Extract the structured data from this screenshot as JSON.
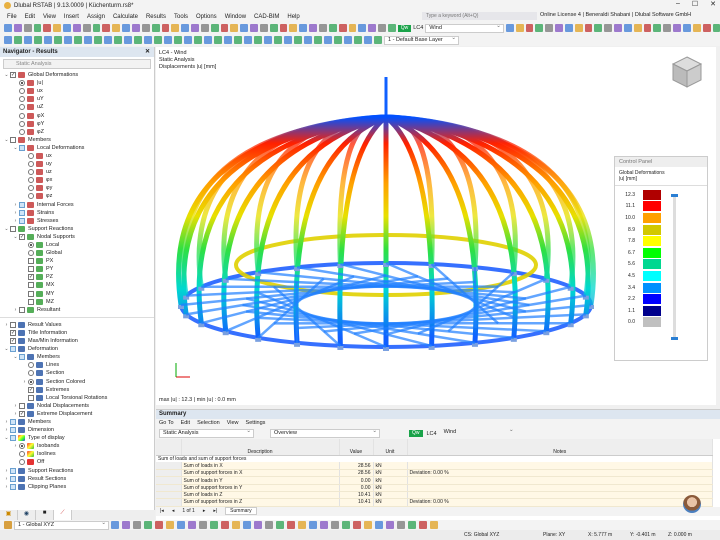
{
  "app": {
    "title": "Dlubal RSTAB | 9.13.0009 | Küchenturm.rs8*",
    "search_placeholder": "Type a keyword (Alt+Q)",
    "license": "Online License 4 | Beneraldi Shabani | Dlubal Software GmbH"
  },
  "menu": [
    "File",
    "Edit",
    "View",
    "Insert",
    "Assign",
    "Calculate",
    "Results",
    "Tools",
    "Options",
    "Window",
    "CAD-BIM",
    "Help"
  ],
  "toolbar": {
    "load_case_badge": "Qw",
    "load_case": "LC4",
    "load_case_name": "Wind",
    "layer": "1 - Default Base Layer"
  },
  "navigator": {
    "title": "Navigator - Results",
    "analysis": "Static Analysis",
    "tree": [
      {
        "lvl": 0,
        "exp": "v",
        "ctl": "box",
        "on": true,
        "icon": "deform",
        "label": "Global Deformations"
      },
      {
        "lvl": 1,
        "ctl": "rad",
        "on": true,
        "icon": "deform",
        "label": "|u|"
      },
      {
        "lvl": 1,
        "ctl": "rad",
        "icon": "deform",
        "label": "ux"
      },
      {
        "lvl": 1,
        "ctl": "rad",
        "icon": "deform",
        "label": "uY"
      },
      {
        "lvl": 1,
        "ctl": "rad",
        "icon": "deform",
        "label": "uZ"
      },
      {
        "lvl": 1,
        "ctl": "rad",
        "icon": "deform",
        "label": "φX"
      },
      {
        "lvl": 1,
        "ctl": "rad",
        "icon": "deform",
        "label": "φY"
      },
      {
        "lvl": 1,
        "ctl": "rad",
        "icon": "deform",
        "label": "φZ"
      },
      {
        "lvl": 0,
        "exp": "v",
        "ctl": "box",
        "icon": "member",
        "label": "Members"
      },
      {
        "lvl": 1,
        "exp": "v",
        "ctl": "boxb",
        "icon": "member",
        "label": "Local Deformations"
      },
      {
        "lvl": 2,
        "ctl": "rad",
        "icon": "member",
        "label": "ux"
      },
      {
        "lvl": 2,
        "ctl": "rad",
        "icon": "member",
        "label": "uy"
      },
      {
        "lvl": 2,
        "ctl": "rad",
        "icon": "member",
        "label": "uz"
      },
      {
        "lvl": 2,
        "ctl": "rad",
        "icon": "member",
        "label": "φx"
      },
      {
        "lvl": 2,
        "ctl": "rad",
        "icon": "member",
        "label": "φy"
      },
      {
        "lvl": 2,
        "ctl": "rad",
        "icon": "member",
        "label": "φz"
      },
      {
        "lvl": 1,
        "exp": ">",
        "ctl": "boxb",
        "icon": "member",
        "label": "Internal Forces"
      },
      {
        "lvl": 1,
        "exp": ">",
        "ctl": "boxb",
        "icon": "member",
        "label": "Strains"
      },
      {
        "lvl": 1,
        "exp": ">",
        "ctl": "boxb",
        "icon": "member",
        "label": "Stresses"
      },
      {
        "lvl": 0,
        "exp": "v",
        "ctl": "box",
        "icon": "support",
        "label": "Support Reactions"
      },
      {
        "lvl": 1,
        "exp": "v",
        "ctl": "box",
        "on": true,
        "icon": "support",
        "label": "Nodal Supports"
      },
      {
        "lvl": 2,
        "ctl": "rad",
        "on": true,
        "icon": "support",
        "label": "Local"
      },
      {
        "lvl": 2,
        "ctl": "rad",
        "icon": "support",
        "label": "Global"
      },
      {
        "lvl": 2,
        "ctl": "box",
        "icon": "support",
        "label": "PX"
      },
      {
        "lvl": 2,
        "ctl": "box",
        "icon": "support",
        "label": "PY"
      },
      {
        "lvl": 2,
        "ctl": "box",
        "on": true,
        "icon": "support",
        "label": "PZ"
      },
      {
        "lvl": 2,
        "ctl": "box",
        "icon": "support",
        "label": "MX"
      },
      {
        "lvl": 2,
        "ctl": "box",
        "icon": "support",
        "label": "MY"
      },
      {
        "lvl": 2,
        "ctl": "box",
        "icon": "support",
        "label": "MZ"
      },
      {
        "lvl": 1,
        "exp": ">",
        "ctl": "box",
        "icon": "support",
        "label": "Resultant"
      },
      {
        "sep": true
      },
      {
        "lvl": 0,
        "exp": ">",
        "ctl": "box",
        "icon": "disp",
        "label": "Result Values"
      },
      {
        "lvl": 0,
        "ctl": "box",
        "on": true,
        "icon": "disp",
        "label": "Title Information"
      },
      {
        "lvl": 0,
        "ctl": "box",
        "on": true,
        "icon": "disp",
        "label": "Max/Min Information"
      },
      {
        "lvl": 0,
        "exp": "v",
        "ctl": "boxb",
        "icon": "disp",
        "label": "Deformation"
      },
      {
        "lvl": 1,
        "exp": "v",
        "ctl": "boxb",
        "icon": "disp",
        "label": "Members"
      },
      {
        "lvl": 2,
        "ctl": "rad",
        "icon": "disp",
        "label": "Lines"
      },
      {
        "lvl": 2,
        "ctl": "rad",
        "icon": "disp",
        "label": "Section"
      },
      {
        "lvl": 2,
        "exp": ">",
        "ctl": "rad",
        "on": true,
        "icon": "disp",
        "label": "Section Colored"
      },
      {
        "lvl": 2,
        "ctl": "box",
        "on": true,
        "icon": "disp",
        "label": "Extremes"
      },
      {
        "lvl": 2,
        "ctl": "box",
        "icon": "disp",
        "label": "Local Torsional Rotations"
      },
      {
        "lvl": 1,
        "exp": ">",
        "ctl": "box",
        "icon": "disp",
        "label": "Nodal Displacements"
      },
      {
        "lvl": 1,
        "exp": ">",
        "ctl": "box",
        "on": true,
        "icon": "disp",
        "label": "Extreme Displacement"
      },
      {
        "lvl": 0,
        "exp": ">",
        "ctl": "boxb",
        "icon": "disp",
        "label": "Members"
      },
      {
        "lvl": 0,
        "exp": ">",
        "ctl": "boxb",
        "icon": "disp",
        "label": "Dimension"
      },
      {
        "lvl": 0,
        "exp": "v",
        "ctl": "boxb",
        "icon": "rainbow",
        "label": "Type of display"
      },
      {
        "lvl": 1,
        "exp": ">",
        "ctl": "rad",
        "on": true,
        "icon": "iso",
        "label": "Isobands"
      },
      {
        "lvl": 1,
        "ctl": "rad",
        "icon": "iso",
        "label": "Isolines"
      },
      {
        "lvl": 1,
        "ctl": "rad",
        "icon": "off",
        "label": "Off"
      },
      {
        "lvl": 0,
        "exp": ">",
        "ctl": "boxb",
        "icon": "disp",
        "label": "Support Reactions"
      },
      {
        "lvl": 0,
        "exp": ">",
        "ctl": "boxb",
        "icon": "disp",
        "label": "Result Sections"
      },
      {
        "lvl": 0,
        "exp": ">",
        "ctl": "boxb",
        "icon": "disp",
        "label": "Clipping Planes"
      }
    ]
  },
  "viewport": {
    "line1": "LC4 - Wind",
    "line2": "Static Analysis",
    "line3": "Displacements |u| [mm]",
    "maxmin": "max |u| : 12.3 | min |u| : 0.0 mm"
  },
  "control_panel": {
    "title": "Control Panel",
    "heading": "Global Deformations",
    "unit": "|u| [mm]",
    "legend": [
      {
        "v": "12.3",
        "c": "#b00000"
      },
      {
        "v": "11.1",
        "c": "#ff0000"
      },
      {
        "v": "10.0",
        "c": "#ffa000"
      },
      {
        "v": "8.9",
        "c": "#d2c800"
      },
      {
        "v": "7.8",
        "c": "#ffff00"
      },
      {
        "v": "6.7",
        "c": "#00ff00"
      },
      {
        "v": "5.6",
        "c": "#00d890"
      },
      {
        "v": "4.5",
        "c": "#00ffff"
      },
      {
        "v": "3.4",
        "c": "#0090ff"
      },
      {
        "v": "2.2",
        "c": "#0000ff"
      },
      {
        "v": "1.1",
        "c": "#00008c"
      },
      {
        "v": "0.0",
        "c": "#c0c0c0"
      }
    ]
  },
  "summary": {
    "title": "Summary",
    "menu": [
      "Go To",
      "Edit",
      "Selection",
      "View",
      "Settings"
    ],
    "analysis": "Static Analysis",
    "view": "Overview",
    "lc_badge": "Qw",
    "lc": "LC4",
    "lc_name": "Wind",
    "columns": [
      "Description",
      "Value",
      "Unit",
      "Notes"
    ],
    "group": "Sum of loads and sum of support forces",
    "rows": [
      [
        "Sum of loads in X",
        "28.56",
        "kN",
        ""
      ],
      [
        "Sum of support forces in X",
        "28.56",
        "kN",
        "Deviation: 0.00 %"
      ],
      [
        "Sum of loads in Y",
        "0.00",
        "kN",
        ""
      ],
      [
        "Sum of support forces in Y",
        "0.00",
        "kN",
        ""
      ],
      [
        "Sum of loads in Z",
        "10.41",
        "kN",
        ""
      ],
      [
        "Sum of support forces in Z",
        "10.41",
        "kN",
        "Deviation: 0.00 %"
      ]
    ],
    "pager": "1 of 1",
    "tab": "Summary"
  },
  "bottom": {
    "cs_select": "1 - Global XYZ"
  },
  "status": {
    "cs": "CS: Global XYZ",
    "plane": "Plane: XY",
    "x": "X: 5.777 m",
    "y": "Y: -0.401 m",
    "z": "Z: 0.000 m"
  }
}
